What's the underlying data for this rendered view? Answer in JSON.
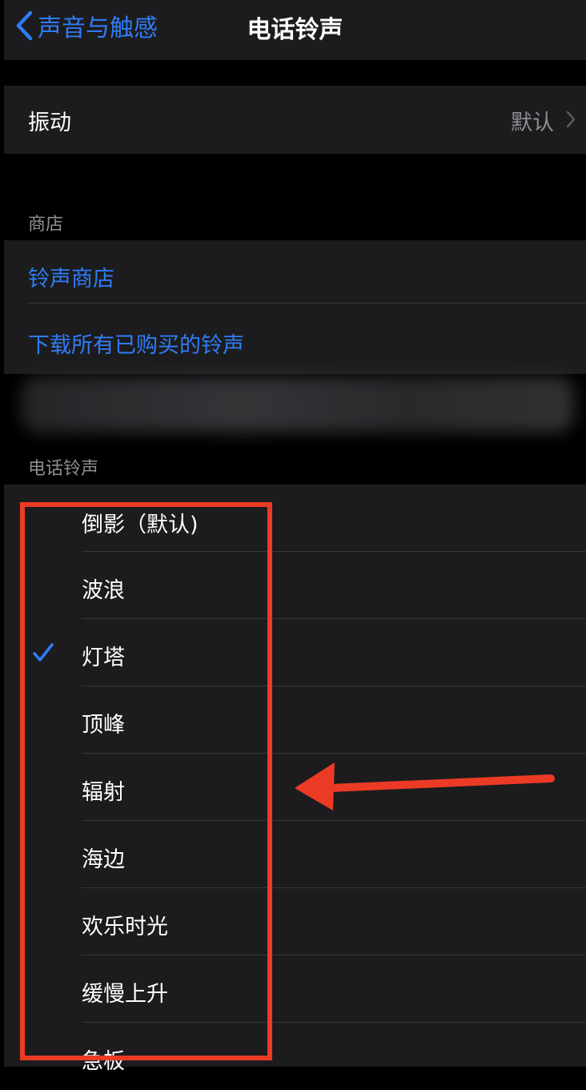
{
  "nav": {
    "back_label": "声音与触感",
    "title": "电话铃声"
  },
  "vibration": {
    "label": "振动",
    "value": "默认"
  },
  "store": {
    "header": "商店",
    "items": [
      {
        "label": "铃声商店"
      },
      {
        "label": "下载所有已购买的铃声"
      }
    ]
  },
  "ringtones": {
    "header": "电话铃声",
    "items": [
      {
        "label": "倒影（默认)",
        "selected": false
      },
      {
        "label": "波浪",
        "selected": false
      },
      {
        "label": "灯塔",
        "selected": true
      },
      {
        "label": "顶峰",
        "selected": false
      },
      {
        "label": "辐射",
        "selected": false
      },
      {
        "label": "海边",
        "selected": false
      },
      {
        "label": "欢乐时光",
        "selected": false
      },
      {
        "label": "缓慢上升",
        "selected": false
      },
      {
        "label": "急板",
        "selected": false
      }
    ]
  },
  "colors": {
    "accent": "#2f7cf6",
    "annotation": "#ec3b25",
    "background": "#000000",
    "cell": "#1c1c1e"
  },
  "icons": {
    "back": "chevron-left-icon",
    "disclosure": "chevron-right-icon",
    "selected": "checkmark-icon"
  }
}
